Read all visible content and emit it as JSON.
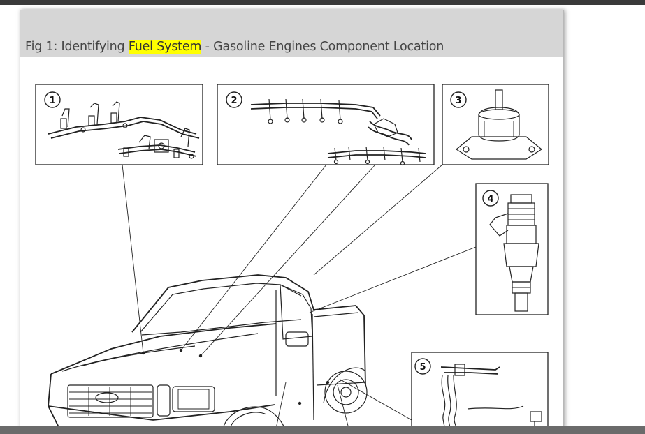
{
  "figure": {
    "caption_prefix": "Fig 1: Identifying ",
    "caption_highlight": "Fuel System",
    "caption_suffix": " - Gasoline Engines Component Location",
    "highlight_color": "#ffff00"
  },
  "callouts": [
    {
      "number": "1"
    },
    {
      "number": "2"
    },
    {
      "number": "3"
    },
    {
      "number": "4"
    },
    {
      "number": "5"
    }
  ],
  "colors": {
    "caption_bar": "#d6d6d6",
    "top_bar": "#3a3a3a",
    "bottom_bar": "#6b6b6b"
  }
}
